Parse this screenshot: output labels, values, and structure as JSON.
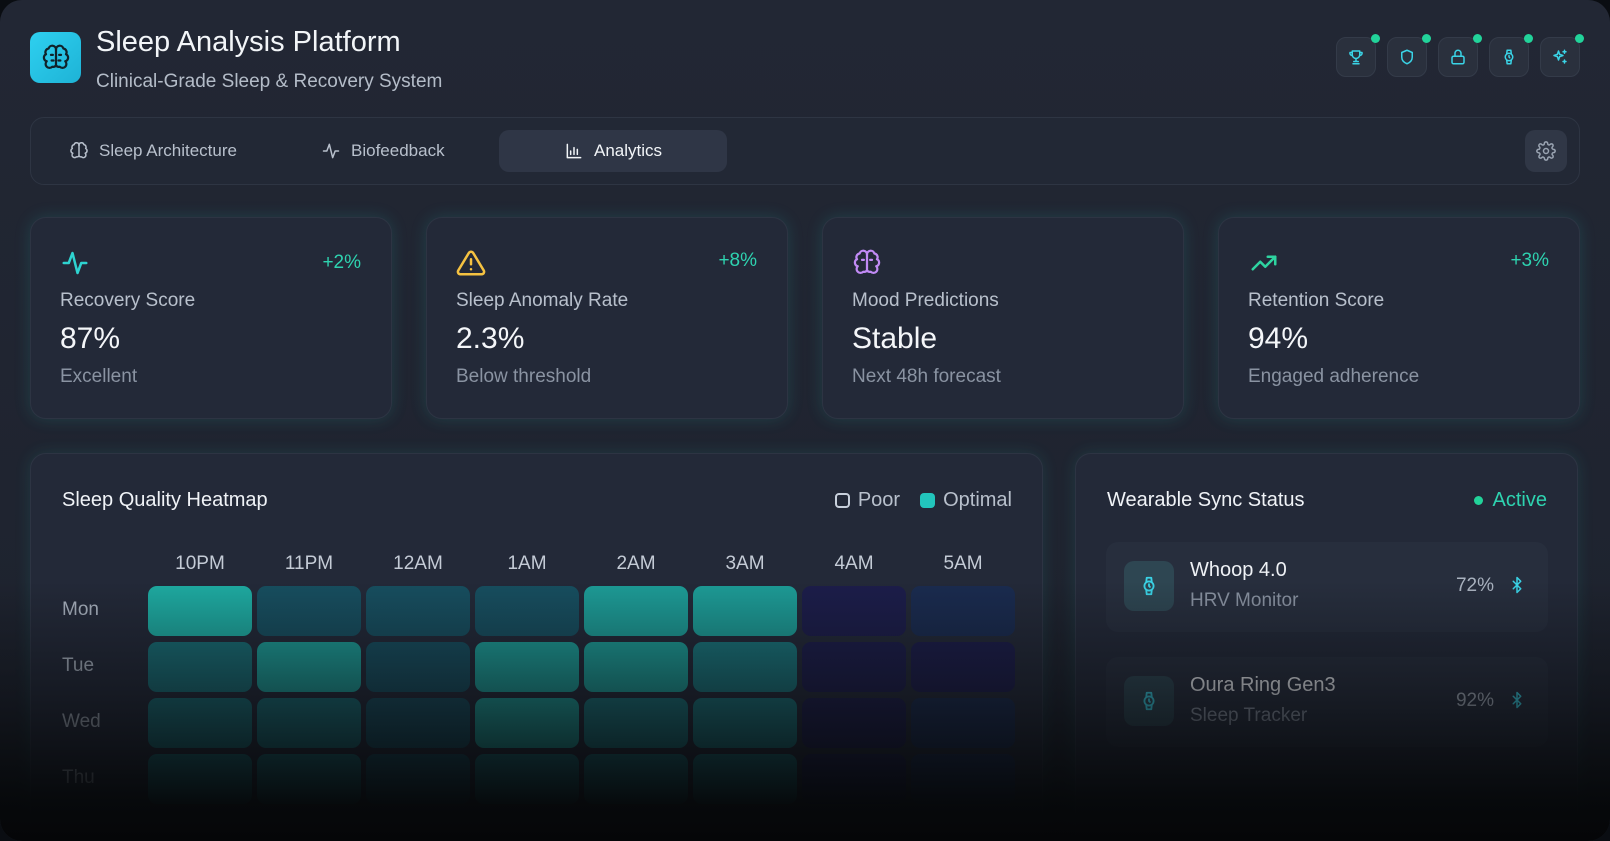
{
  "header": {
    "title": "Sleep Analysis Platform",
    "subtitle": "Clinical-Grade Sleep & Recovery System",
    "icons": [
      "trophy-icon",
      "shield-icon",
      "lock-icon",
      "watch-icon",
      "sparkles-icon"
    ]
  },
  "tabs": [
    {
      "label": "Sleep Architecture",
      "icon": "brain-icon",
      "active": false
    },
    {
      "label": "Biofeedback",
      "icon": "activity-icon",
      "active": false
    },
    {
      "label": "Analytics",
      "icon": "bar-chart-icon",
      "active": true
    }
  ],
  "metrics": [
    {
      "label": "Recovery Score",
      "value": "87%",
      "sub": "Excellent",
      "delta": "+2%",
      "icon": "activity-icon",
      "color": "#2ed3d0"
    },
    {
      "label": "Sleep Anomaly Rate",
      "value": "2.3%",
      "sub": "Below threshold",
      "delta": "+8%",
      "icon": "warning-icon",
      "color": "#f5c241"
    },
    {
      "label": "Mood Predictions",
      "value": "Stable",
      "sub": "Next 48h forecast",
      "delta": "",
      "icon": "brain-icon",
      "color": "#c18af5"
    },
    {
      "label": "Retention Score",
      "value": "94%",
      "sub": "Engaged adherence",
      "delta": "+3%",
      "icon": "trending-up-icon",
      "color": "#2ed3a0"
    }
  ],
  "heatmap": {
    "title": "Sleep Quality Heatmap",
    "legend_poor": "Poor",
    "legend_optimal": "Optimal",
    "hours": [
      "10PM",
      "11PM",
      "12AM",
      "1AM",
      "2AM",
      "3AM",
      "4AM",
      "5AM"
    ],
    "days": [
      "Mon",
      "Tue",
      "Wed",
      "Thu"
    ],
    "colors": {
      "optimal": "#1fb2a6",
      "poor": "#1c1d4a"
    },
    "levels": [
      [
        0.95,
        0.35,
        0.35,
        0.35,
        0.85,
        0.85,
        0.0,
        0.1
      ],
      [
        0.55,
        0.85,
        0.35,
        0.85,
        0.85,
        0.6,
        0.0,
        0.0
      ],
      [
        0.55,
        0.55,
        0.35,
        0.85,
        0.6,
        0.6,
        0.0,
        0.1
      ],
      [
        0.55,
        0.55,
        0.35,
        0.55,
        0.55,
        0.55,
        0.0,
        0.1
      ]
    ]
  },
  "sync": {
    "title": "Wearable Sync Status",
    "status": "Active",
    "devices": [
      {
        "name": "Whoop 4.0",
        "type": "HRV Monitor",
        "battery": "72%"
      },
      {
        "name": "Oura Ring Gen3",
        "type": "Sleep Tracker",
        "battery": "92%"
      }
    ]
  }
}
